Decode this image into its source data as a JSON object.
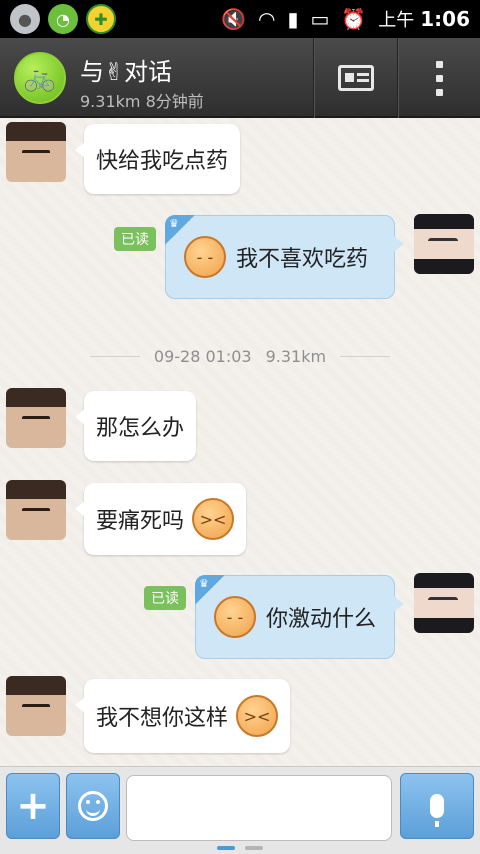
{
  "status_bar": {
    "apps": [
      "people-app-icon",
      "wechat-icon",
      "360-security-icon"
    ],
    "indicators": [
      "mute-icon",
      "wifi-icon",
      "signal-icon",
      "battery-icon",
      "alarm-icon"
    ],
    "ampm": "上午",
    "time": "1:06"
  },
  "header": {
    "name": "与✌对话",
    "subtitle": "9.31km 8分钟前",
    "avatar_icon": "bicycle-icon",
    "buttons": [
      "profile-card-icon",
      "more-vertical-icon"
    ]
  },
  "timeline": {
    "date": "09-28 01:03",
    "distance": "9.31km"
  },
  "messages": [
    {
      "side": "left",
      "text": "快给我吃点药",
      "emoji": ""
    },
    {
      "side": "right",
      "text": "我不喜欢吃药",
      "emoji": "sleepy-face-icon",
      "read": "已读"
    },
    {
      "side": "left",
      "text": "那怎么办",
      "emoji": ""
    },
    {
      "side": "left",
      "text": "要痛死吗",
      "emoji": "angry-face-icon"
    },
    {
      "side": "right",
      "text": "你激动什么",
      "emoji": "sleepy-face-icon",
      "read": "已读"
    },
    {
      "side": "left",
      "text": "我不想你这样",
      "emoji": "angry-face-icon"
    }
  ],
  "input_bar": {
    "add_label": "+",
    "input_value": "",
    "icons": [
      "plus-icon",
      "smiley-icon",
      "microphone-icon"
    ]
  },
  "colors": {
    "accent_blue": "#5c9fd8",
    "read_green": "#7ac05c",
    "bubble_blue": "#cfe6f7"
  }
}
